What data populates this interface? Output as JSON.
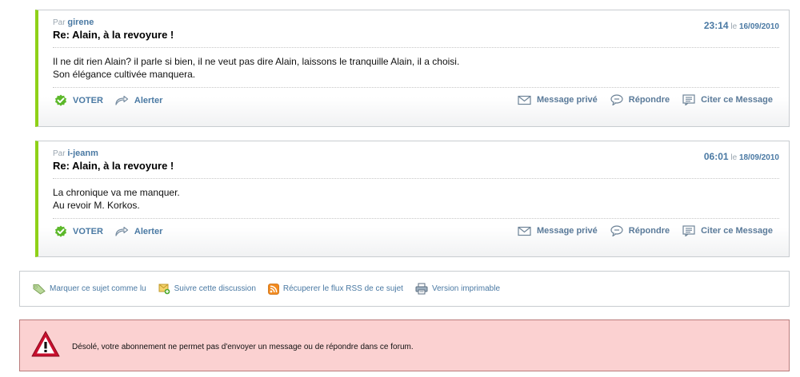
{
  "posts": [
    {
      "by_label": "Par",
      "author": "girene",
      "subject": "Re: Alain, à la revoyure !",
      "time": "23:14",
      "date_prefix": "le",
      "date": "16/09/2010",
      "lines": [
        "Il ne dit rien Alain? il parle si bien, il ne veut pas dire Alain, laissons le tranquille Alain, il a choisi.",
        "Son élégance cultivée manquera."
      ],
      "actions": {
        "vote": "VOTER",
        "alert": "Alerter",
        "private_message": "Message privé",
        "reply": "Répondre",
        "quote": "Citer ce Message"
      }
    },
    {
      "by_label": "Par",
      "author": "i-jeanm",
      "subject": "Re: Alain, à la revoyure !",
      "time": "06:01",
      "date_prefix": "le",
      "date": "18/09/2010",
      "lines": [
        "La chronique va me manquer.",
        "Au revoir M. Korkos."
      ],
      "actions": {
        "vote": "VOTER",
        "alert": "Alerter",
        "private_message": "Message privé",
        "reply": "Répondre",
        "quote": "Citer ce Message"
      }
    }
  ],
  "toolbar": {
    "mark_read": "Marquer ce sujet comme lu",
    "follow": "Suivre cette discussion",
    "rss": "Récuperer le flux RSS de ce sujet",
    "print": "Version imprimable"
  },
  "error": {
    "message": "Désolé, votre abonnement ne permet pas d'envoyer un message ou de répondre dans ce forum."
  },
  "colors": {
    "accent_green": "#8fd118",
    "link_blue": "#4a79a3",
    "error_bg": "#fbd1d1",
    "warning_red": "#c8102e"
  },
  "icons": [
    "vote-check-icon",
    "alert-arrow-icon",
    "envelope-icon",
    "speech-bubble-icon",
    "quote-icon",
    "tag-icon",
    "follow-icon",
    "rss-icon",
    "printer-icon",
    "warning-triangle-icon"
  ]
}
